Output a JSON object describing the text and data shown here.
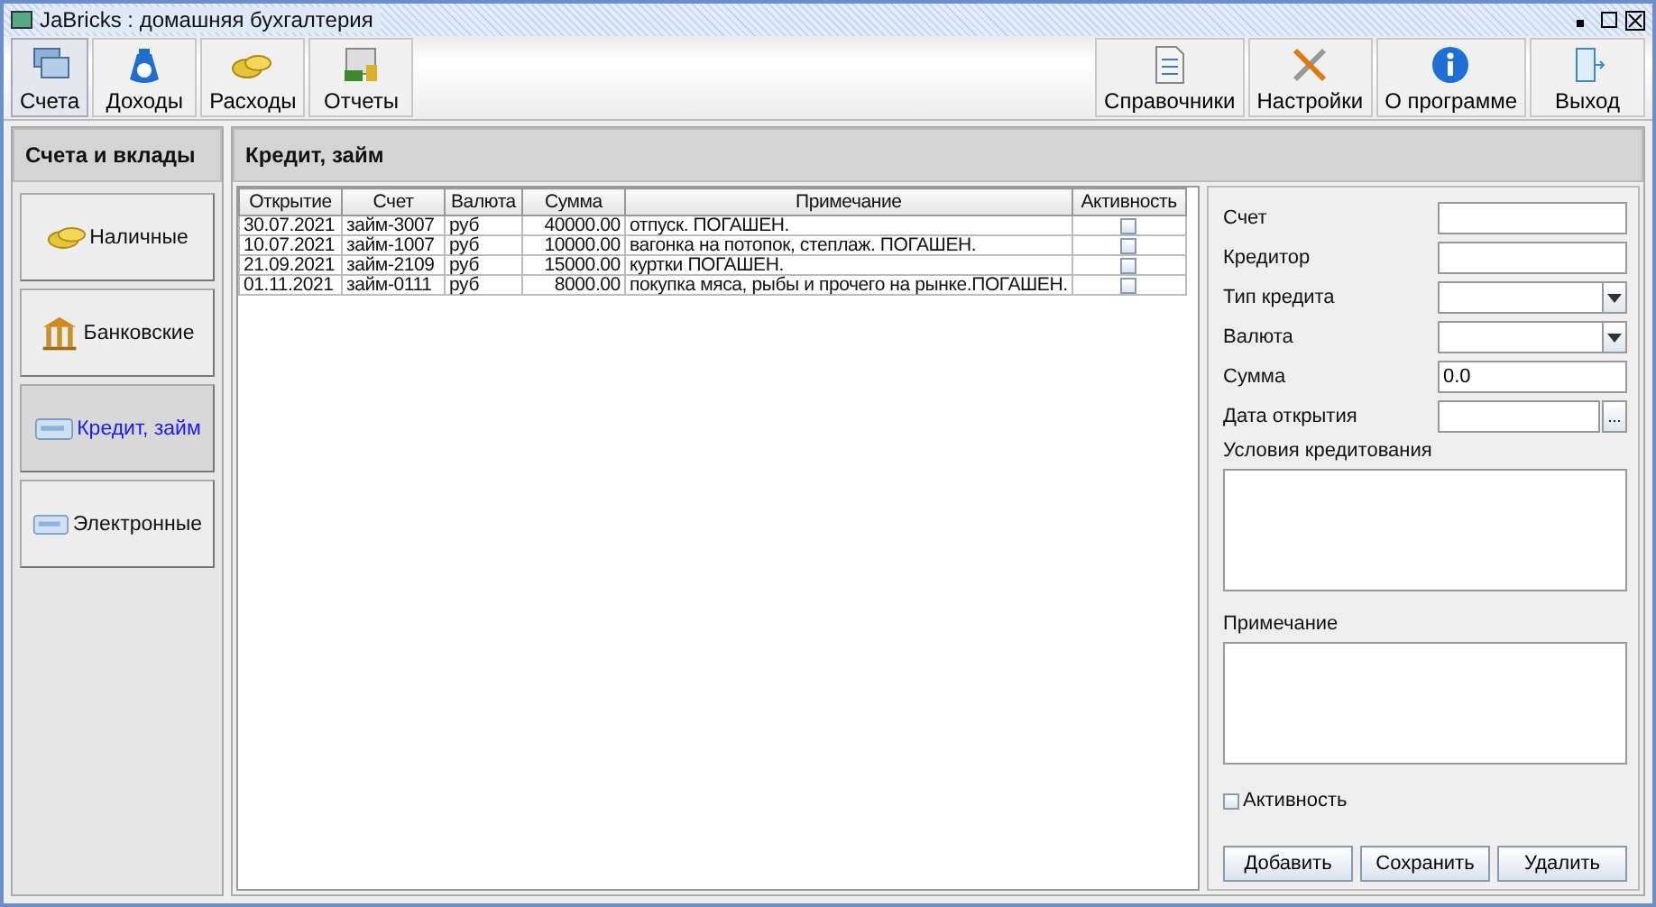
{
  "window": {
    "title": "JaBricks : домашняя бухгалтерия"
  },
  "toolbar": {
    "left": [
      {
        "label": "Счета",
        "selected": true
      },
      {
        "label": "Доходы",
        "selected": false
      },
      {
        "label": "Расходы",
        "selected": false
      },
      {
        "label": "Отчеты",
        "selected": false
      }
    ],
    "right": [
      {
        "label": "Справочники"
      },
      {
        "label": "Настройки"
      },
      {
        "label": "О программе"
      },
      {
        "label": "Выход"
      }
    ]
  },
  "sidebar": {
    "title": "Счета и вклады",
    "items": [
      {
        "label": "Наличные",
        "selected": false
      },
      {
        "label": "Банковские",
        "selected": false
      },
      {
        "label": "Кредит, займ",
        "selected": true
      },
      {
        "label": "Электронные",
        "selected": false
      }
    ]
  },
  "content": {
    "title": "Кредит, займ"
  },
  "table": {
    "columns": [
      "Открытие",
      "Счет",
      "Валюта",
      "Сумма",
      "Примечание",
      "Активность"
    ],
    "rows": [
      {
        "cells": [
          "30.07.2021",
          "займ-3007",
          "руб",
          "40000.00",
          "отпуск. ПОГАШЕН."
        ],
        "active": false
      },
      {
        "cells": [
          "10.07.2021",
          "займ-1007",
          "руб",
          "10000.00",
          "вагонка на потопок, степлаж. ПОГАШЕН."
        ],
        "active": false
      },
      {
        "cells": [
          "21.09.2021",
          "займ-2109",
          "руб",
          "15000.00",
          "куртки ПОГАШЕН."
        ],
        "active": false
      },
      {
        "cells": [
          "01.11.2021",
          "займ-0111",
          "руб",
          "8000.00",
          "покупка мяса, рыбы и прочего на рынке.ПОГАШЕН."
        ],
        "active": false
      }
    ]
  },
  "form": {
    "fields": [
      {
        "label": "Счет",
        "kind": "text"
      },
      {
        "label": "Кредитор",
        "kind": "text"
      },
      {
        "label": "Тип кредита",
        "kind": "combo"
      },
      {
        "label": "Валюта",
        "kind": "combo"
      },
      {
        "label": "Сумма",
        "kind": "text",
        "value": "0.0"
      },
      {
        "label": "Дата открытия",
        "kind": "date",
        "button": "..."
      }
    ],
    "areas": [
      {
        "label": "Условия кредитования"
      },
      {
        "label": "Примечание"
      }
    ],
    "checkbox": {
      "label": "Активность",
      "checked": false
    },
    "buttons": [
      "Добавить",
      "Сохранить",
      "Удалить"
    ]
  }
}
